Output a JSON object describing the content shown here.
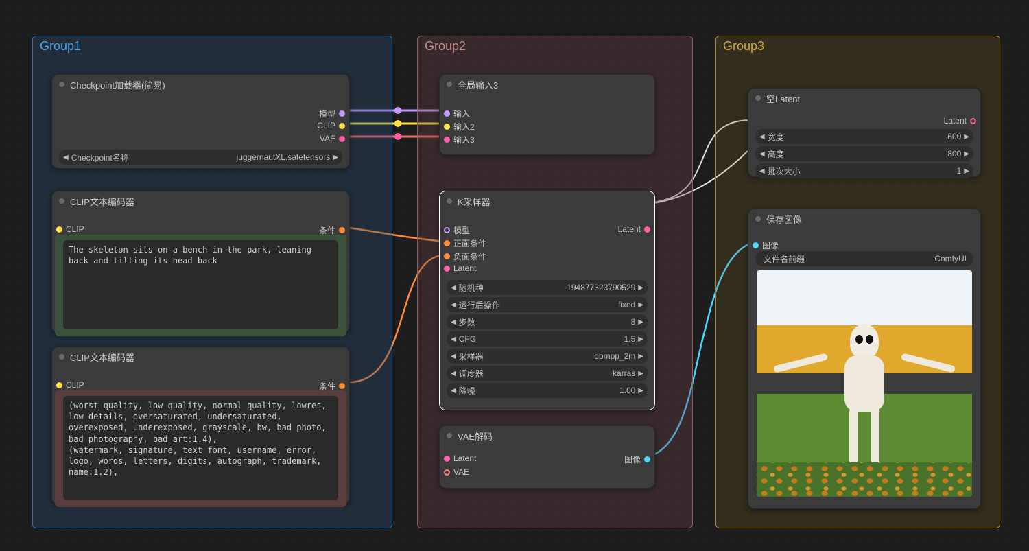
{
  "groups": {
    "g1": "Group1",
    "g2": "Group2",
    "g3": "Group3"
  },
  "checkpoint": {
    "title": "Checkpoint加载器(简易)",
    "outputs": {
      "model": "模型",
      "clip": "CLIP",
      "vae": "VAE"
    },
    "widget": {
      "label": "Checkpoint名称",
      "value": "juggernautXL.safetensors"
    }
  },
  "clip_pos": {
    "title": "CLIP文本编码器",
    "in_clip": "CLIP",
    "out_cond": "条件",
    "text": "The skeleton sits on a bench in the park, leaning back and tilting its head back"
  },
  "clip_neg": {
    "title": "CLIP文本编码器",
    "in_clip": "CLIP",
    "out_cond": "条件",
    "text": "(worst quality, low quality, normal quality, lowres, low details, oversaturated, undersaturated, overexposed, underexposed, grayscale, bw, bad photo, bad photography, bad art:1.4),\n(watermark, signature, text font, username, error, logo, words, letters, digits, autograph, trademark, name:1.2),"
  },
  "global_in": {
    "title": "全局输入3",
    "in1": "输入",
    "in2": "输入2",
    "in3": "输入3"
  },
  "ksampler": {
    "title": "K采样器",
    "in_model": "模型",
    "in_pos": "正面条件",
    "in_neg": "负面条件",
    "in_latent": "Latent",
    "out_latent": "Latent",
    "widgets": {
      "seed": {
        "label": "随机种",
        "value": "194877323790529"
      },
      "after": {
        "label": "运行后操作",
        "value": "fixed"
      },
      "steps": {
        "label": "步数",
        "value": "8"
      },
      "cfg": {
        "label": "CFG",
        "value": "1.5"
      },
      "sampler": {
        "label": "采样器",
        "value": "dpmpp_2m"
      },
      "sched": {
        "label": "调度器",
        "value": "karras"
      },
      "denoise": {
        "label": "降噪",
        "value": "1.00"
      }
    }
  },
  "vae_decode": {
    "title": "VAE解码",
    "in_latent": "Latent",
    "in_vae": "VAE",
    "out_image": "图像"
  },
  "empty_latent": {
    "title": "空Latent",
    "out_latent": "Latent",
    "widgets": {
      "w": {
        "label": "宽度",
        "value": "600"
      },
      "h": {
        "label": "高度",
        "value": "800"
      },
      "b": {
        "label": "批次大小",
        "value": "1"
      }
    }
  },
  "save": {
    "title": "保存图像",
    "in_image": "图像",
    "widget": {
      "label": "文件名前缀",
      "value": "ComfyUI"
    }
  }
}
